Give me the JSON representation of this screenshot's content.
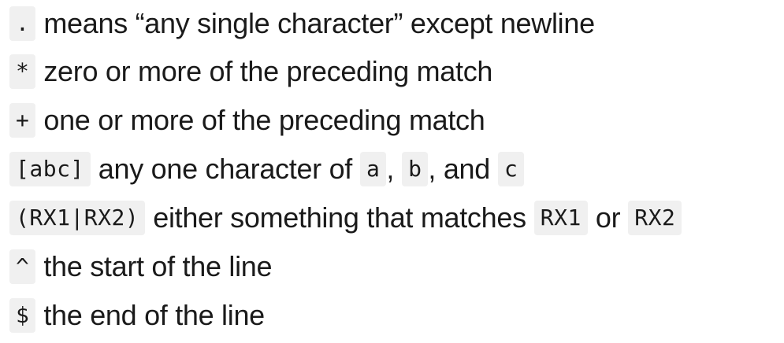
{
  "lines": [
    {
      "code": ".",
      "text": "means “any single character” except newline"
    },
    {
      "code": "*",
      "text": "zero or more of the preceding match"
    },
    {
      "code": "+",
      "text": "one or more of the preceding match"
    },
    {
      "code": "[abc]",
      "text": "any one character of",
      "code_a": "a",
      "sep1": ",",
      "code_b": "b",
      "sep2": ", and",
      "code_c": "c"
    },
    {
      "code": "(RX1|RX2)",
      "text": "either something that matches",
      "code_rx1": "RX1",
      "sep": "or",
      "code_rx2": "RX2"
    },
    {
      "code": "^",
      "text": "the start of the line"
    },
    {
      "code": "$",
      "text": "the end of the line"
    }
  ]
}
